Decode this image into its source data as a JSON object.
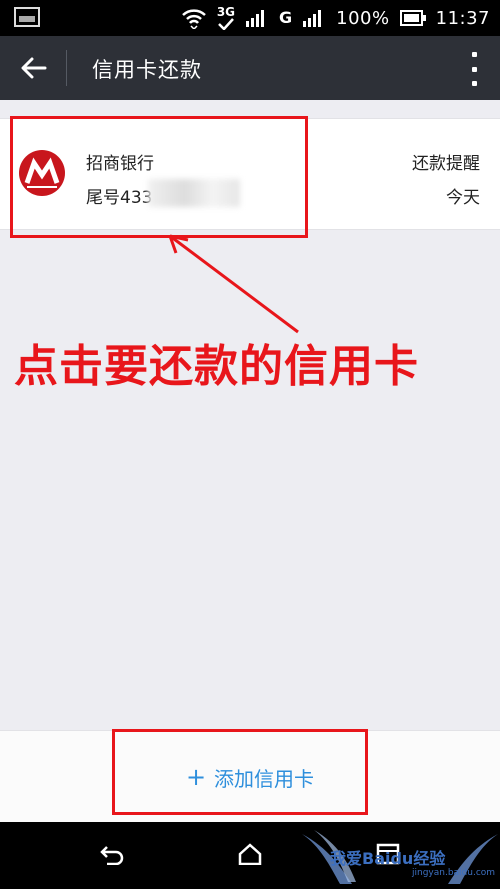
{
  "status_bar": {
    "network_label": "3G",
    "network_label_2": "G",
    "battery_percent": "100%",
    "time": "11:37"
  },
  "app_bar": {
    "title": "信用卡还款",
    "back_icon": "arrow-left-icon",
    "more_icon": "more-vertical-icon"
  },
  "card": {
    "bank_name": "招商银行",
    "tail_number": "尾号433",
    "remind_label": "还款提醒",
    "remind_day": "今天",
    "logo_color": "#c8161d"
  },
  "annotation": {
    "text": "点击要还款的信用卡",
    "color": "#e8161b"
  },
  "add_card": {
    "plus": "+",
    "label": "添加信用卡",
    "color": "#2e8fdc"
  },
  "nav_bar": {
    "back_icon": "nav-back-icon",
    "home_icon": "home-icon",
    "recent_icon": "recent-apps-icon"
  },
  "watermark": {
    "text": "我爱Baidu经验",
    "sub": "jingyan.baidu.com"
  }
}
